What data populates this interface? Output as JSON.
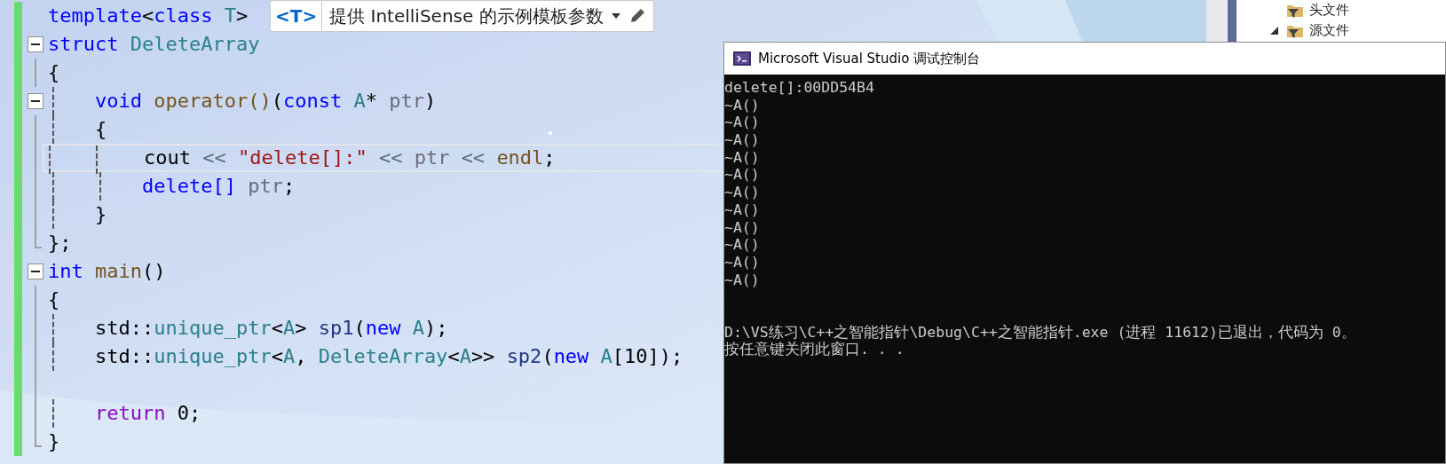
{
  "editor": {
    "lines": [
      {
        "kind": "plain",
        "current": false,
        "tokens": [
          {
            "text": "template",
            "kind": "kw"
          },
          {
            "text": "<",
            "kind": "plain"
          },
          {
            "text": "class",
            "kind": "kw"
          },
          {
            "text": " T",
            "kind": "type"
          },
          {
            "text": ">",
            "kind": "plain"
          }
        ]
      },
      {
        "kind": "fold-start",
        "expanded": true,
        "current": false,
        "tokens": [
          {
            "text": "struct ",
            "kind": "kw"
          },
          {
            "text": "DeleteArray",
            "kind": "type"
          }
        ]
      },
      {
        "kind": "fold-body",
        "current": false,
        "tokens": [
          {
            "text": "{",
            "kind": "plain"
          }
        ]
      },
      {
        "kind": "fold-start",
        "expanded": true,
        "current": false,
        "tokens": [
          {
            "text": "    void ",
            "kind": "kw"
          },
          {
            "text": "operator()",
            "kind": "func"
          },
          {
            "text": "(",
            "kind": "plain"
          },
          {
            "text": "const ",
            "kind": "kw"
          },
          {
            "text": "A",
            "kind": "type"
          },
          {
            "text": "* ",
            "kind": "plain"
          },
          {
            "text": "ptr",
            "kind": "param"
          },
          {
            "text": ")",
            "kind": "plain"
          }
        ]
      },
      {
        "kind": "fold-body",
        "current": false,
        "tokens": [
          {
            "text": "    {",
            "kind": "plain"
          }
        ]
      },
      {
        "kind": "fold-body",
        "current": true,
        "tokens": [
          {
            "text": "        cout ",
            "kind": "plain"
          },
          {
            "text": "<< ",
            "kind": "op"
          },
          {
            "text": "\"delete[]:\" ",
            "kind": "str"
          },
          {
            "text": "<< ",
            "kind": "op"
          },
          {
            "text": "ptr ",
            "kind": "param"
          },
          {
            "text": "<< ",
            "kind": "op"
          },
          {
            "text": "endl",
            "kind": "func"
          },
          {
            "text": ";",
            "kind": "plain"
          }
        ]
      },
      {
        "kind": "fold-body",
        "current": false,
        "tokens": [
          {
            "text": "        delete[] ",
            "kind": "kw"
          },
          {
            "text": "ptr",
            "kind": "param"
          },
          {
            "text": ";",
            "kind": "plain"
          }
        ]
      },
      {
        "kind": "fold-body",
        "current": false,
        "tokens": [
          {
            "text": "    }",
            "kind": "plain"
          }
        ]
      },
      {
        "kind": "fold-end",
        "current": false,
        "tokens": [
          {
            "text": "};",
            "kind": "plain"
          }
        ]
      },
      {
        "kind": "fold-start",
        "expanded": true,
        "current": false,
        "tokens": [
          {
            "text": "int ",
            "kind": "kw"
          },
          {
            "text": "main",
            "kind": "func"
          },
          {
            "text": "()",
            "kind": "plain"
          }
        ]
      },
      {
        "kind": "fold-body",
        "current": false,
        "tokens": [
          {
            "text": "{",
            "kind": "plain"
          }
        ]
      },
      {
        "kind": "fold-body",
        "current": false,
        "tokens": [
          {
            "text": "    std::",
            "kind": "plain"
          },
          {
            "text": "unique_ptr",
            "kind": "type"
          },
          {
            "text": "<",
            "kind": "plain"
          },
          {
            "text": "A",
            "kind": "type"
          },
          {
            "text": "> ",
            "kind": "plain"
          },
          {
            "text": "sp1",
            "kind": "local"
          },
          {
            "text": "(",
            "kind": "plain"
          },
          {
            "text": "new ",
            "kind": "kw"
          },
          {
            "text": "A",
            "kind": "type"
          },
          {
            "text": ");",
            "kind": "plain"
          }
        ]
      },
      {
        "kind": "fold-body",
        "current": false,
        "tokens": [
          {
            "text": "    std::",
            "kind": "plain"
          },
          {
            "text": "unique_ptr",
            "kind": "type"
          },
          {
            "text": "<",
            "kind": "plain"
          },
          {
            "text": "A",
            "kind": "type"
          },
          {
            "text": ", ",
            "kind": "plain"
          },
          {
            "text": "DeleteArray",
            "kind": "type"
          },
          {
            "text": "<",
            "kind": "plain"
          },
          {
            "text": "A",
            "kind": "type"
          },
          {
            "text": ">> ",
            "kind": "plain"
          },
          {
            "text": "sp2",
            "kind": "local"
          },
          {
            "text": "(",
            "kind": "plain"
          },
          {
            "text": "new ",
            "kind": "kw"
          },
          {
            "text": "A",
            "kind": "type"
          },
          {
            "text": "[10]);",
            "kind": "plain"
          }
        ]
      },
      {
        "kind": "fold-body"
      },
      {
        "kind": "fold-body",
        "current": false,
        "tokens": [
          {
            "text": "    return",
            "kind": "ctl"
          },
          {
            "text": " 0;",
            "kind": "plain"
          }
        ]
      },
      {
        "kind": "fold-end",
        "current": false,
        "tokens": [
          {
            "text": "}",
            "kind": "plain"
          }
        ]
      }
    ],
    "tooltip": {
      "badge": "<T>",
      "text": "提供 IntelliSense 的示例模板参数"
    }
  },
  "solution_explorer": {
    "items": [
      {
        "label": "头文件",
        "expanded": false
      },
      {
        "label": "源文件",
        "expanded": true
      }
    ]
  },
  "console": {
    "title": "Microsoft Visual Studio 调试控制台",
    "lines": [
      "delete[]:00DD54B4",
      "~A()",
      "~A()",
      "~A()",
      "~A()",
      "~A()",
      "~A()",
      "~A()",
      "~A()",
      "~A()",
      "~A()",
      "~A()"
    ],
    "footer": [
      "D:\\VS练习\\C++之智能指针\\Debug\\C++之智能指针.exe (进程 11612)已退出，代码为 0。",
      "按任意键关闭此窗口. . ."
    ]
  }
}
